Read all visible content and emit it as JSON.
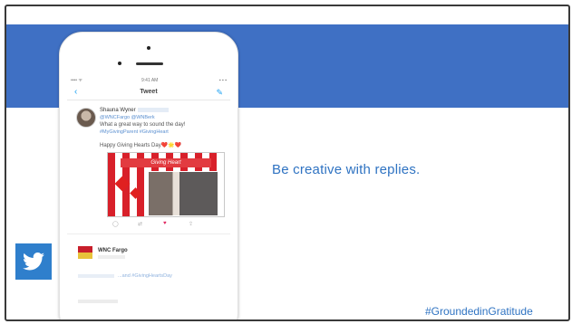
{
  "phone": {
    "status_left": "•••• ᯤ",
    "status_time": "9:41 AM",
    "status_right": "▪ ▪ ▪",
    "nav_back": "‹",
    "nav_title": "Tweet",
    "nav_compose_icon": "compose-icon",
    "tweet": {
      "author": "Shauna Wyner",
      "mentions": "@WNCFargo @WNBerk",
      "text": "What a great way to sound the day!",
      "hashtags": "#MyGivingParent #GivingHeart",
      "second_line": "Happy Giving Hearts Day",
      "emoji": "❤️🌟❤️",
      "image_banner": "Giving Heart"
    },
    "actions": {
      "reply": "◯",
      "retweet": "⇄",
      "like": "♥",
      "share": "⇪"
    },
    "reply": {
      "name": "WNC Fargo",
      "link": "...and #GivingHeartsDay"
    }
  },
  "headline": "Be creative with replies.",
  "hashtag": "#GroundedinGratitude",
  "colors": {
    "band": "#3f70c4",
    "accent_text": "#2f73c2",
    "twitter_badge": "#2f7fcc"
  },
  "icons": [
    "twitter-bird-icon",
    "back-chevron-icon",
    "compose-icon",
    "heart-icon"
  ]
}
